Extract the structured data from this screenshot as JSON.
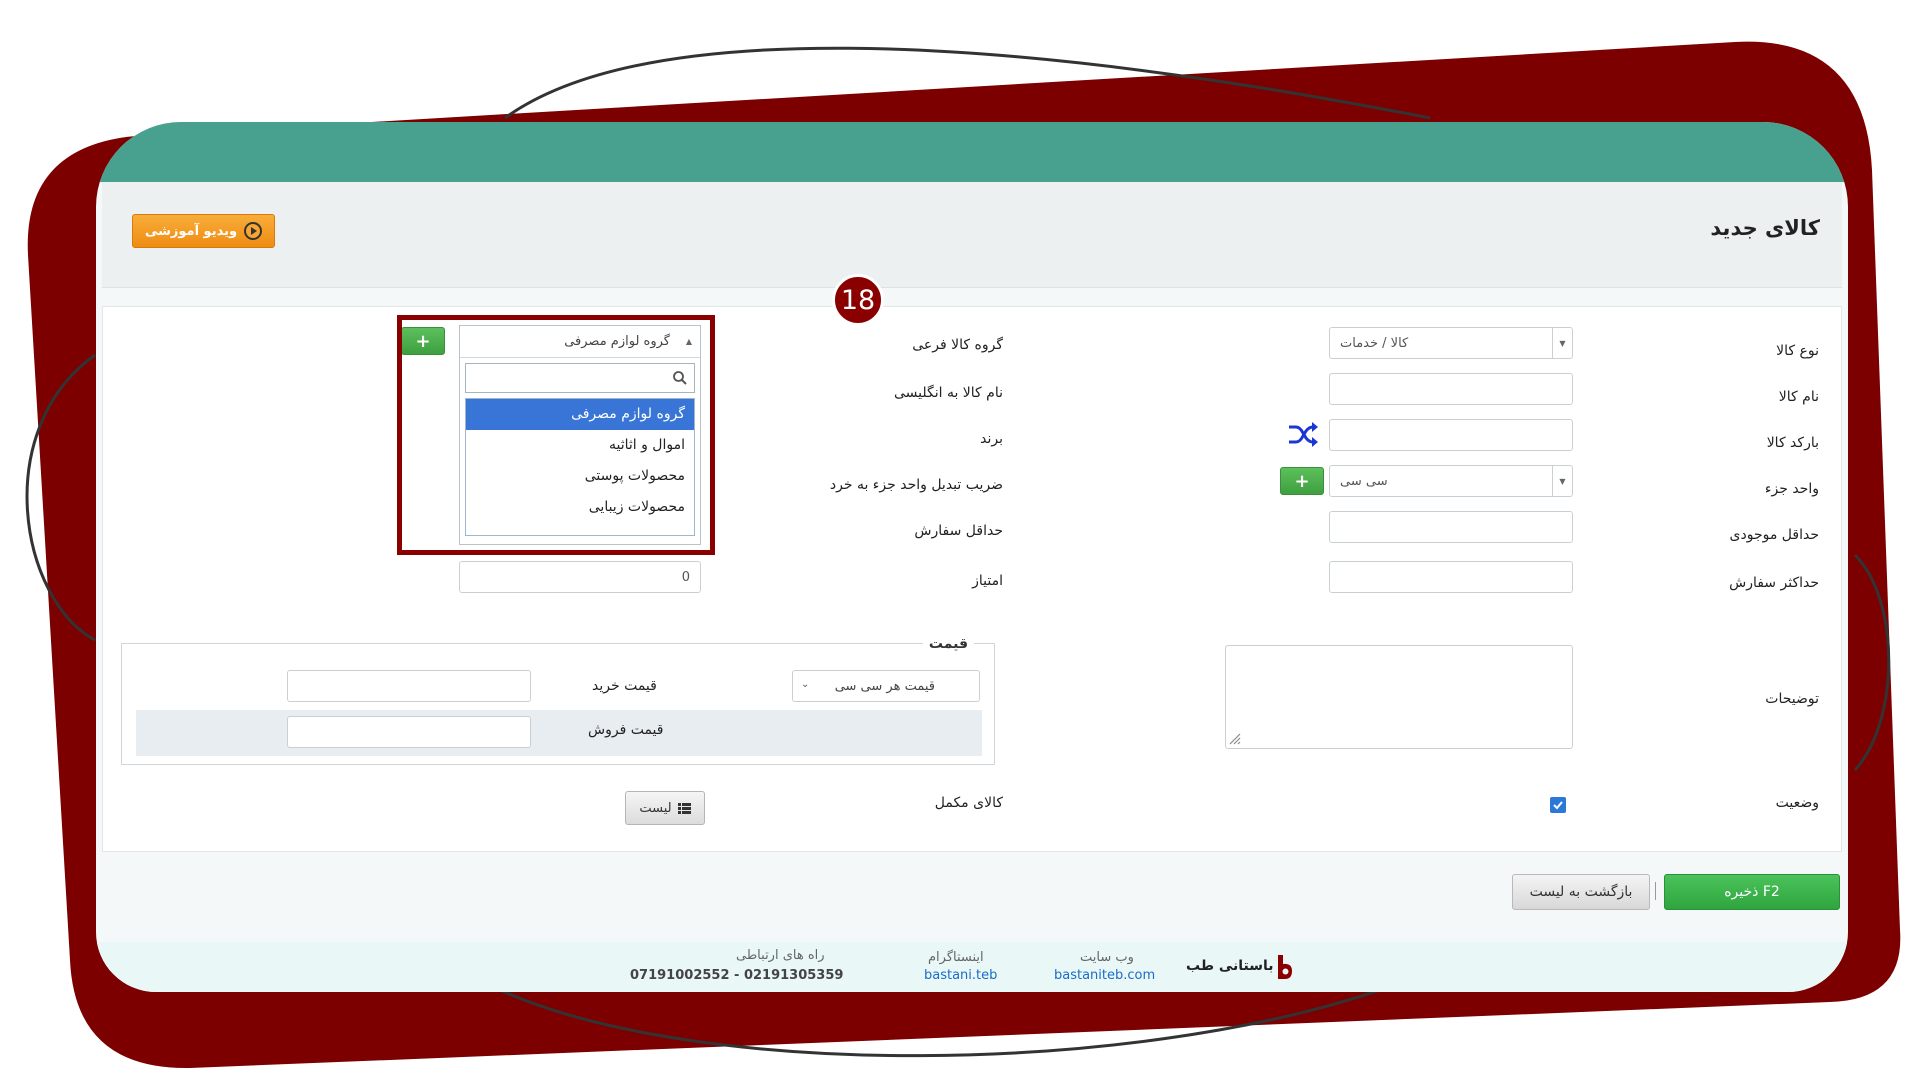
{
  "header": {
    "title": "کالای جدید",
    "video_button": "ویدیو آموزشی"
  },
  "tutorial": {
    "step_number": "18"
  },
  "form": {
    "goods_type": {
      "label": "نوع کالا",
      "value": "کالا / خدمات"
    },
    "goods_name": {
      "label": "نام کالا",
      "value": ""
    },
    "barcode": {
      "label": "بارکد کالا",
      "value": ""
    },
    "part_unit": {
      "label": "واحد جزء",
      "value": "سی سی"
    },
    "min_stock": {
      "label": "حداقل موجودی",
      "value": ""
    },
    "max_order": {
      "label": "حداکثر سفارش",
      "value": ""
    },
    "description": {
      "label": "توضیحات",
      "value": ""
    },
    "status": {
      "label": "وضعیت",
      "checked": true
    },
    "sub_group": {
      "label": "گروه کالا فرعی",
      "value": "گروه لوازم مصرفی",
      "search_value": "",
      "options": [
        "گروه لوازم مصرفی",
        "اموال و اثاثیه",
        "محصولات پوستی",
        "محصولات زیبایی"
      ],
      "selected_index": 0
    },
    "english_name": {
      "label": "نام کالا به انگلیسی"
    },
    "brand": {
      "label": "برند"
    },
    "conversion_factor": {
      "label": "ضریب تبدیل واحد جزء به خرد"
    },
    "min_order": {
      "label": "حداقل سفارش"
    },
    "score": {
      "label": "امتیاز",
      "value": "0"
    },
    "price": {
      "legend": "قیمت",
      "unit_select": "قیمت هر سی سی",
      "buy_label": "قیمت خرید",
      "sell_label": "قیمت فروش",
      "buy_value": "",
      "sell_value": ""
    },
    "complementary": {
      "label": "کالای مکمل",
      "button": "لیست"
    }
  },
  "actions": {
    "save": "F2 ذخیره",
    "back": "بازگشت به لیست"
  },
  "footer": {
    "brand": "باستانی طب",
    "website_label": "وب سایت",
    "website": "bastaniteb.com",
    "instagram_label": "اینستاگرام",
    "instagram": "bastani.teb",
    "contact_label": "راه های ارتباطی",
    "phones": "07191002552 - 02191305359"
  },
  "colors": {
    "accent_green": "#48a18e",
    "frame_red": "#8a0000",
    "save_green": "#2ea53e",
    "primary_blue": "#3875d7"
  }
}
